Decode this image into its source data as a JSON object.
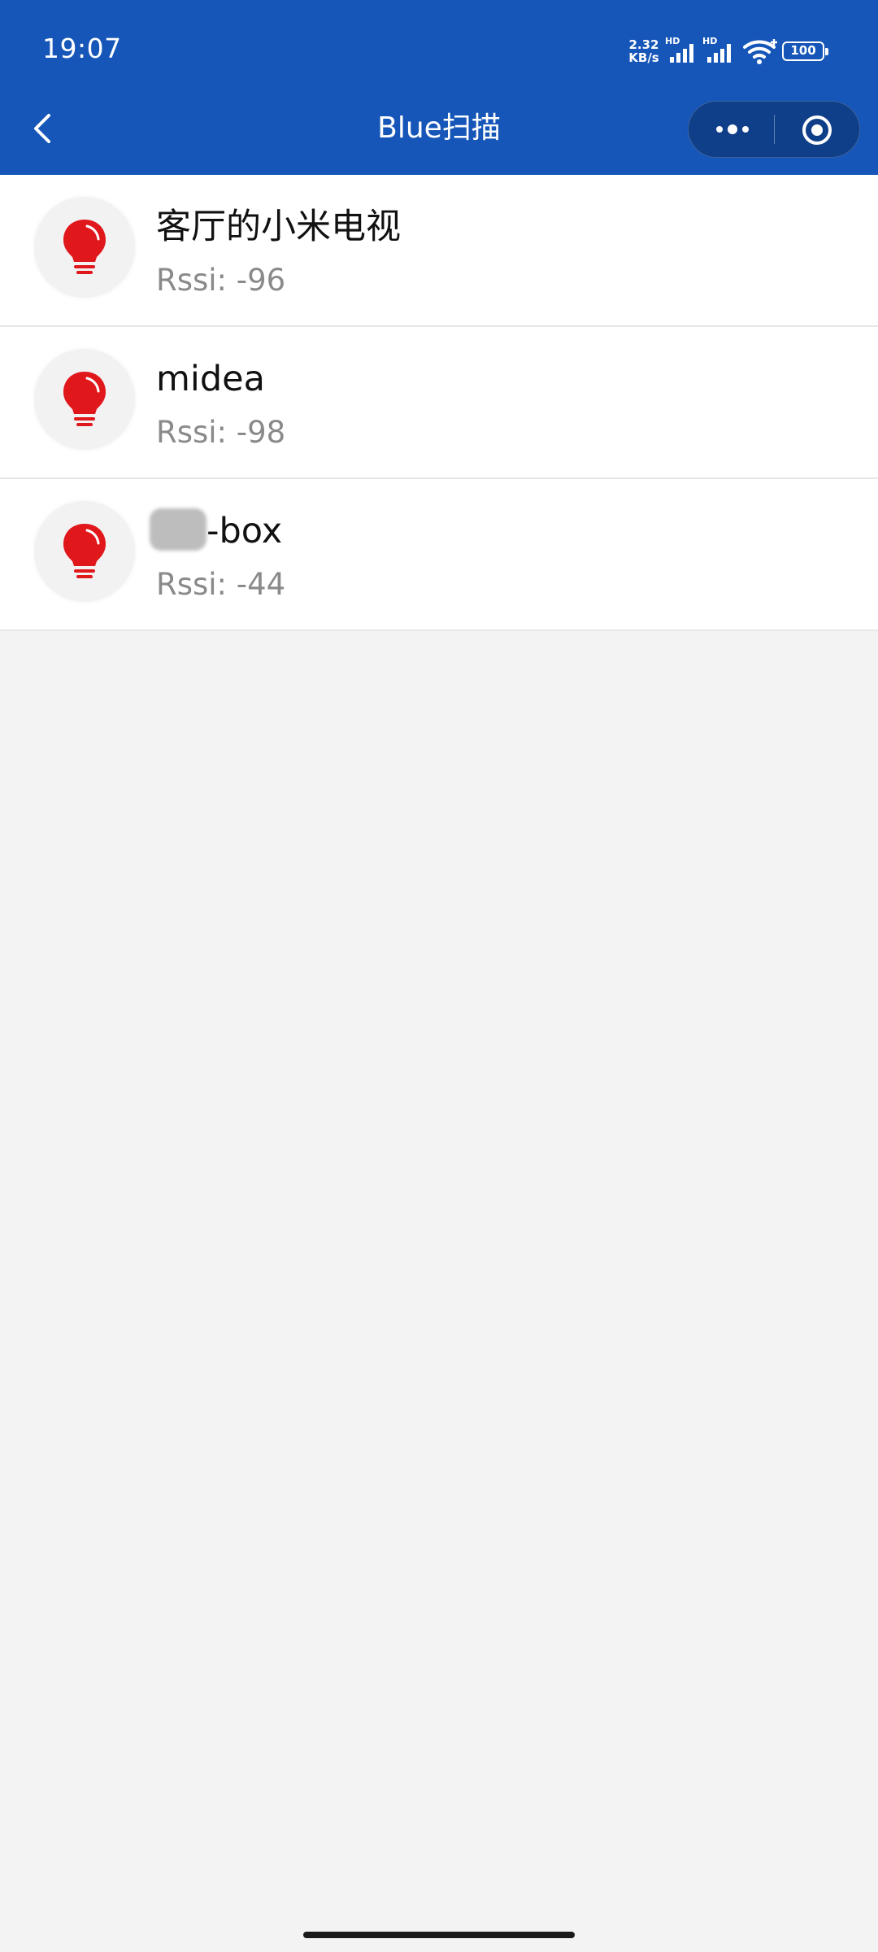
{
  "status_bar": {
    "time": "19:07",
    "net_speed_value": "2.32",
    "net_speed_unit": "KB/s",
    "signal_1_label": "HD",
    "signal_2_label": "HD",
    "battery_level": "100"
  },
  "nav": {
    "title": "Blue扫描"
  },
  "devices": [
    {
      "name": "客厅的小米电视",
      "rssi": "Rssi: -96"
    },
    {
      "name": "midea",
      "rssi": "Rssi: -98"
    },
    {
      "name": "-box",
      "rssi": "Rssi: -44"
    }
  ],
  "colors": {
    "header_bg": "#1656b8",
    "bulb_red": "#e0171b",
    "page_bg": "#f3f3f3"
  },
  "icons": {
    "device_icon": "lightbulb-icon"
  }
}
